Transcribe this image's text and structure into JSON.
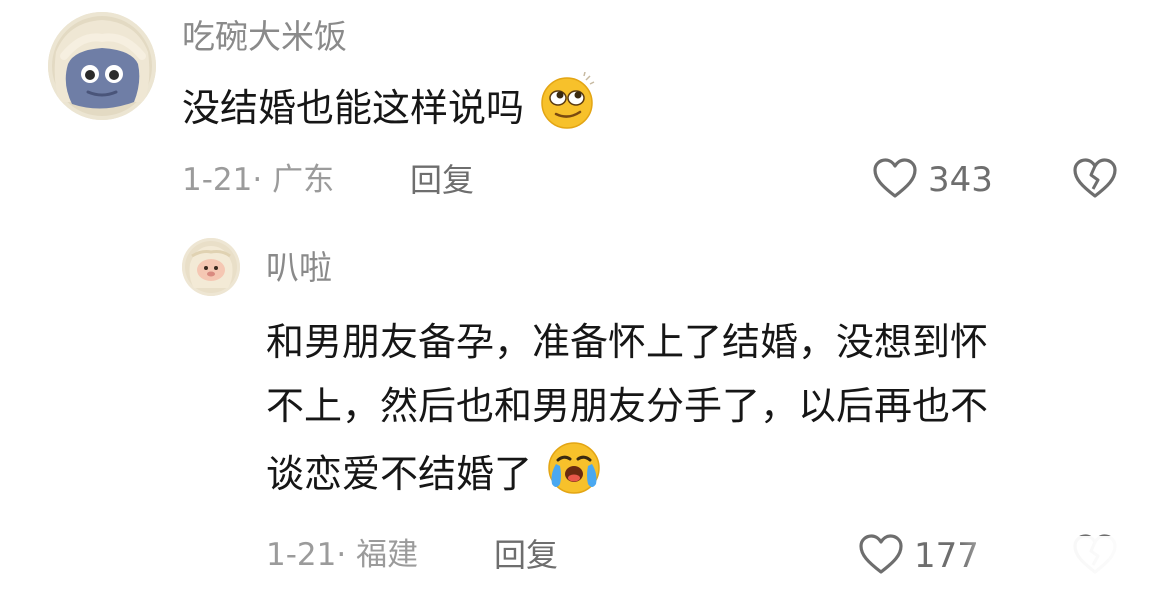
{
  "comments": [
    {
      "username": "吃碗大米饭",
      "text": "没结婚也能这样说吗",
      "emoji": "rolling-eyes-emoji",
      "date_location": "1-21· 广东",
      "reply_label": "回复",
      "like_count": "343",
      "avatar": "blue-yeti-avatar",
      "replies": [
        {
          "username": "叭啦",
          "text_lines": [
            "和男朋友备孕，准备怀上了结婚，没想到怀",
            "不上，然后也和男朋友分手了，以后再也不",
            "谈恋爱不结婚了"
          ],
          "emoji": "crying-emoji",
          "date_location": "1-21· 福建",
          "reply_label": "回复",
          "like_count": "177",
          "avatar": "cream-plush-avatar"
        }
      ]
    }
  ],
  "colors": {
    "username": "#8a8a8a",
    "text": "#161616",
    "meta": "#9b9b9b",
    "icon": "#6e6e6e",
    "emoji_yellow": "#f7c12b"
  },
  "watermark": {
    "text": ""
  }
}
